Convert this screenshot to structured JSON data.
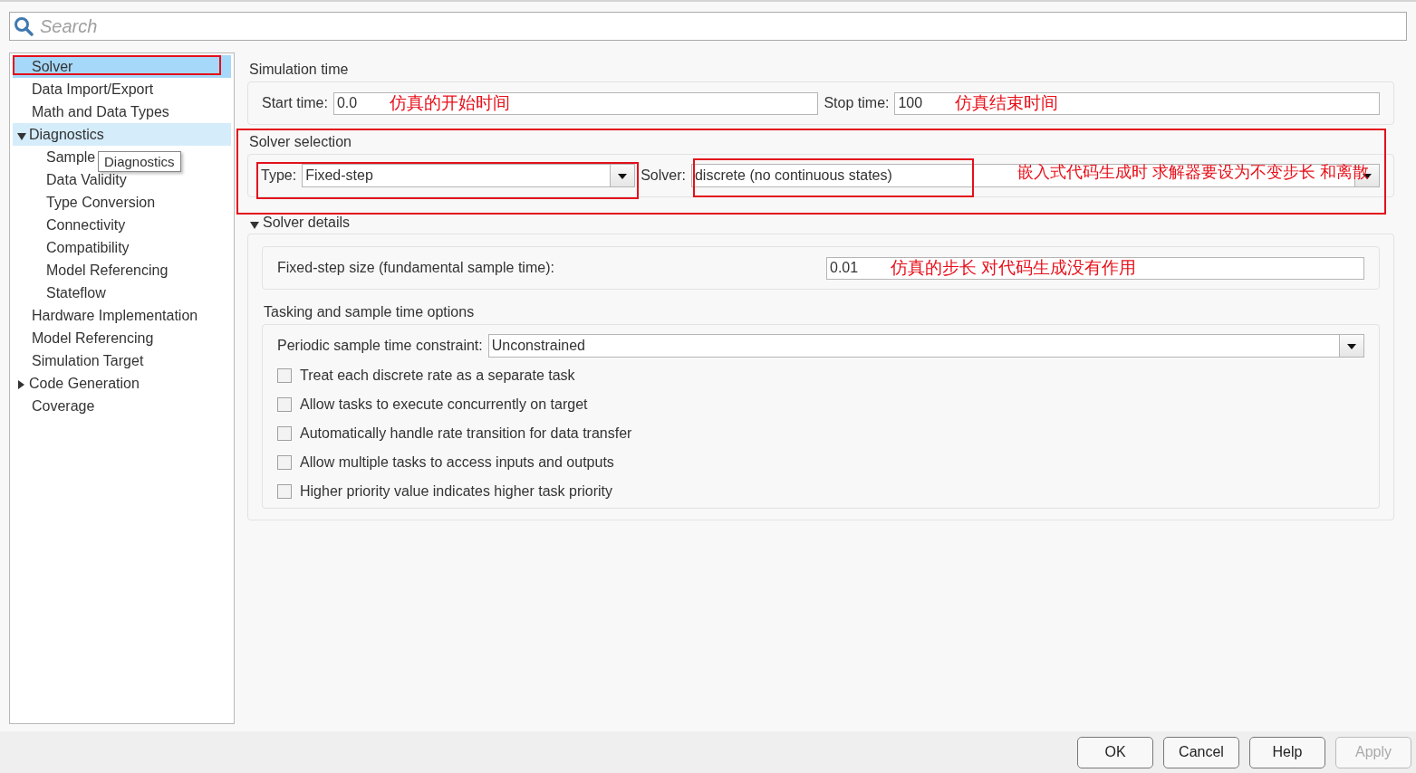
{
  "search": {
    "placeholder": "Search"
  },
  "sidebar": {
    "items": [
      {
        "label": "Solver",
        "selected": true,
        "annotated": true
      },
      {
        "label": "Data Import/Export",
        "selected": false
      },
      {
        "label": "Math and Data Types",
        "selected": false
      },
      {
        "label": "Diagnostics",
        "selected": false,
        "hovered": true,
        "expanded": true,
        "children": [
          {
            "label": "Sample",
            "selected": false
          },
          {
            "label": "Data Validity",
            "selected": false
          },
          {
            "label": "Type Conversion",
            "selected": false
          },
          {
            "label": "Connectivity",
            "selected": false
          },
          {
            "label": "Compatibility",
            "selected": false
          },
          {
            "label": "Model Referencing",
            "selected": false
          },
          {
            "label": "Stateflow",
            "selected": false
          }
        ]
      },
      {
        "label": "Hardware Implementation",
        "selected": false
      },
      {
        "label": "Model Referencing",
        "selected": false
      },
      {
        "label": "Simulation Target",
        "selected": false
      },
      {
        "label": "Code Generation",
        "selected": false,
        "expanded": false
      },
      {
        "label": "Coverage",
        "selected": false
      }
    ],
    "tooltip": "Diagnostics"
  },
  "simulation_time": {
    "title": "Simulation time",
    "start_label": "Start time:",
    "start_value": "0.0",
    "start_note": "仿真的开始时间",
    "stop_label": "Stop time:",
    "stop_value": "100",
    "stop_note": "仿真结束时间"
  },
  "solver_selection": {
    "title": "Solver selection",
    "type_label": "Type:",
    "type_value": "Fixed-step",
    "solver_label": "Solver:",
    "solver_value": "discrete (no continuous states)",
    "note": "嵌入式代码生成时 求解器要设为不变步长 和离散"
  },
  "solver_details": {
    "title": "Solver details",
    "expanded": true,
    "step_label": "Fixed-step size (fundamental sample time):",
    "step_value": "0.01",
    "step_note": "仿真的步长  对代码生成没有作用",
    "tasking_title": "Tasking and sample time options",
    "constraint_label": "Periodic sample time constraint:",
    "constraint_value": "Unconstrained",
    "options": [
      {
        "label": "Treat each discrete rate as a separate task",
        "checked": false
      },
      {
        "label": "Allow tasks to execute concurrently on target",
        "checked": false
      },
      {
        "label": "Automatically handle rate transition for data transfer",
        "checked": false
      },
      {
        "label": "Allow multiple tasks to access inputs and outputs",
        "checked": false
      },
      {
        "label": "Higher priority value indicates higher task priority",
        "checked": false
      }
    ]
  },
  "buttons": [
    {
      "label": "OK",
      "disabled": false
    },
    {
      "label": "Cancel",
      "disabled": false
    },
    {
      "label": "Help",
      "disabled": false
    },
    {
      "label": "Apply",
      "disabled": true
    }
  ]
}
